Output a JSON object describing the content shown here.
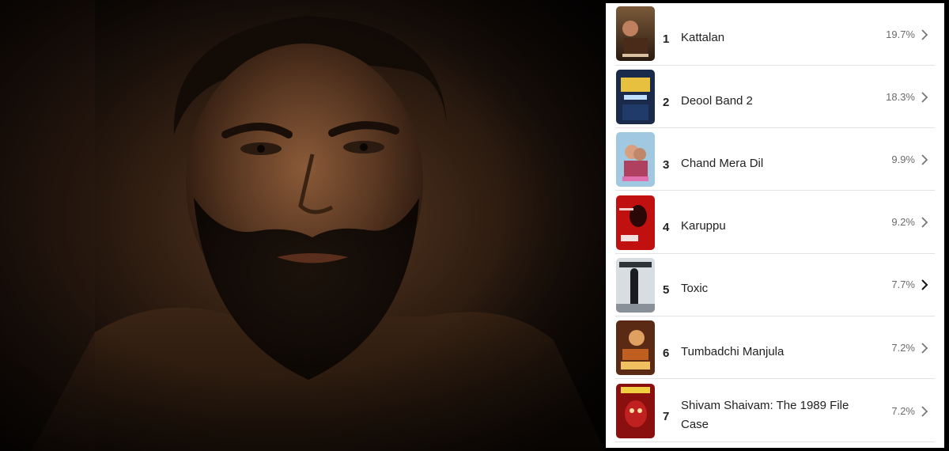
{
  "list": {
    "items": [
      {
        "rank": "1",
        "title": "Kattalan",
        "pct": "19.7%"
      },
      {
        "rank": "2",
        "title": "Deool Band 2",
        "pct": "18.3%"
      },
      {
        "rank": "3",
        "title": "Chand Mera Dil",
        "pct": "9.9%"
      },
      {
        "rank": "4",
        "title": "Karuppu",
        "pct": "9.2%"
      },
      {
        "rank": "5",
        "title": "Toxic",
        "pct": "7.7%"
      },
      {
        "rank": "6",
        "title": "Tumbadchi Manjula",
        "pct": "7.2%"
      },
      {
        "rank": "7",
        "title": "Shivam Shaivam: The 1989 File Case",
        "pct": "7.2%"
      }
    ]
  },
  "icons": {
    "chevron": "chevron-right-icon"
  },
  "colors": {
    "panel_bg": "#ffffff",
    "text": "#222222",
    "muted": "#6b6b6b",
    "divider": "#e3e3e3"
  }
}
